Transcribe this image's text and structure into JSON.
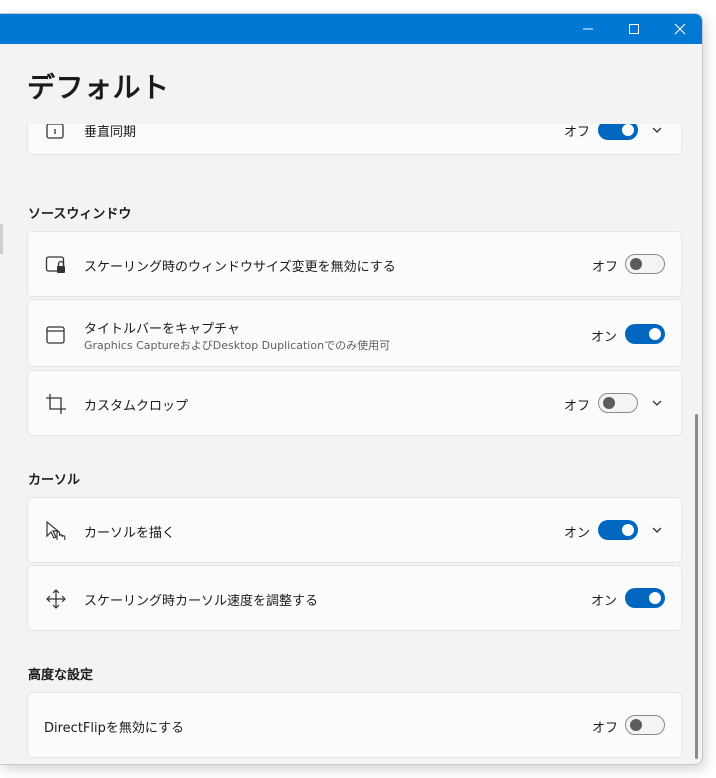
{
  "window": {
    "title_controls": {
      "minimize": "—",
      "maximize": "☐",
      "close": "✕"
    }
  },
  "page": {
    "title": "デフォルト"
  },
  "partial_row": {
    "label": "垂直同期",
    "state": "オフ"
  },
  "sections": {
    "source_window": {
      "header": "ソースウィンドウ",
      "rows": [
        {
          "label": "スケーリング時のウィンドウサイズ変更を無効にする",
          "state": "オフ",
          "on": false,
          "icon": "window-lock-icon"
        },
        {
          "label": "タイトルバーをキャプチャ",
          "sublabel": "Graphics CaptureおよびDesktop Duplicationでのみ使用可",
          "state": "オン",
          "on": true,
          "icon": "window-icon"
        },
        {
          "label": "カスタムクロップ",
          "state": "オフ",
          "on": false,
          "icon": "crop-icon",
          "expandable": true
        }
      ]
    },
    "cursor": {
      "header": "カーソル",
      "rows": [
        {
          "label": "カーソルを描く",
          "state": "オン",
          "on": true,
          "icon": "cursor-hand-icon",
          "expandable": true
        },
        {
          "label": "スケーリング時カーソル速度を調整する",
          "state": "オン",
          "on": true,
          "icon": "move-arrows-icon"
        }
      ]
    },
    "advanced": {
      "header": "高度な設定",
      "rows": [
        {
          "label": "DirectFlipを無効にする",
          "state": "オフ",
          "on": false
        }
      ]
    }
  },
  "colors": {
    "accent": "#0078d4",
    "toggle_on": "#0067c0",
    "background": "#f3f3f3",
    "card": "#fbfbfb"
  }
}
